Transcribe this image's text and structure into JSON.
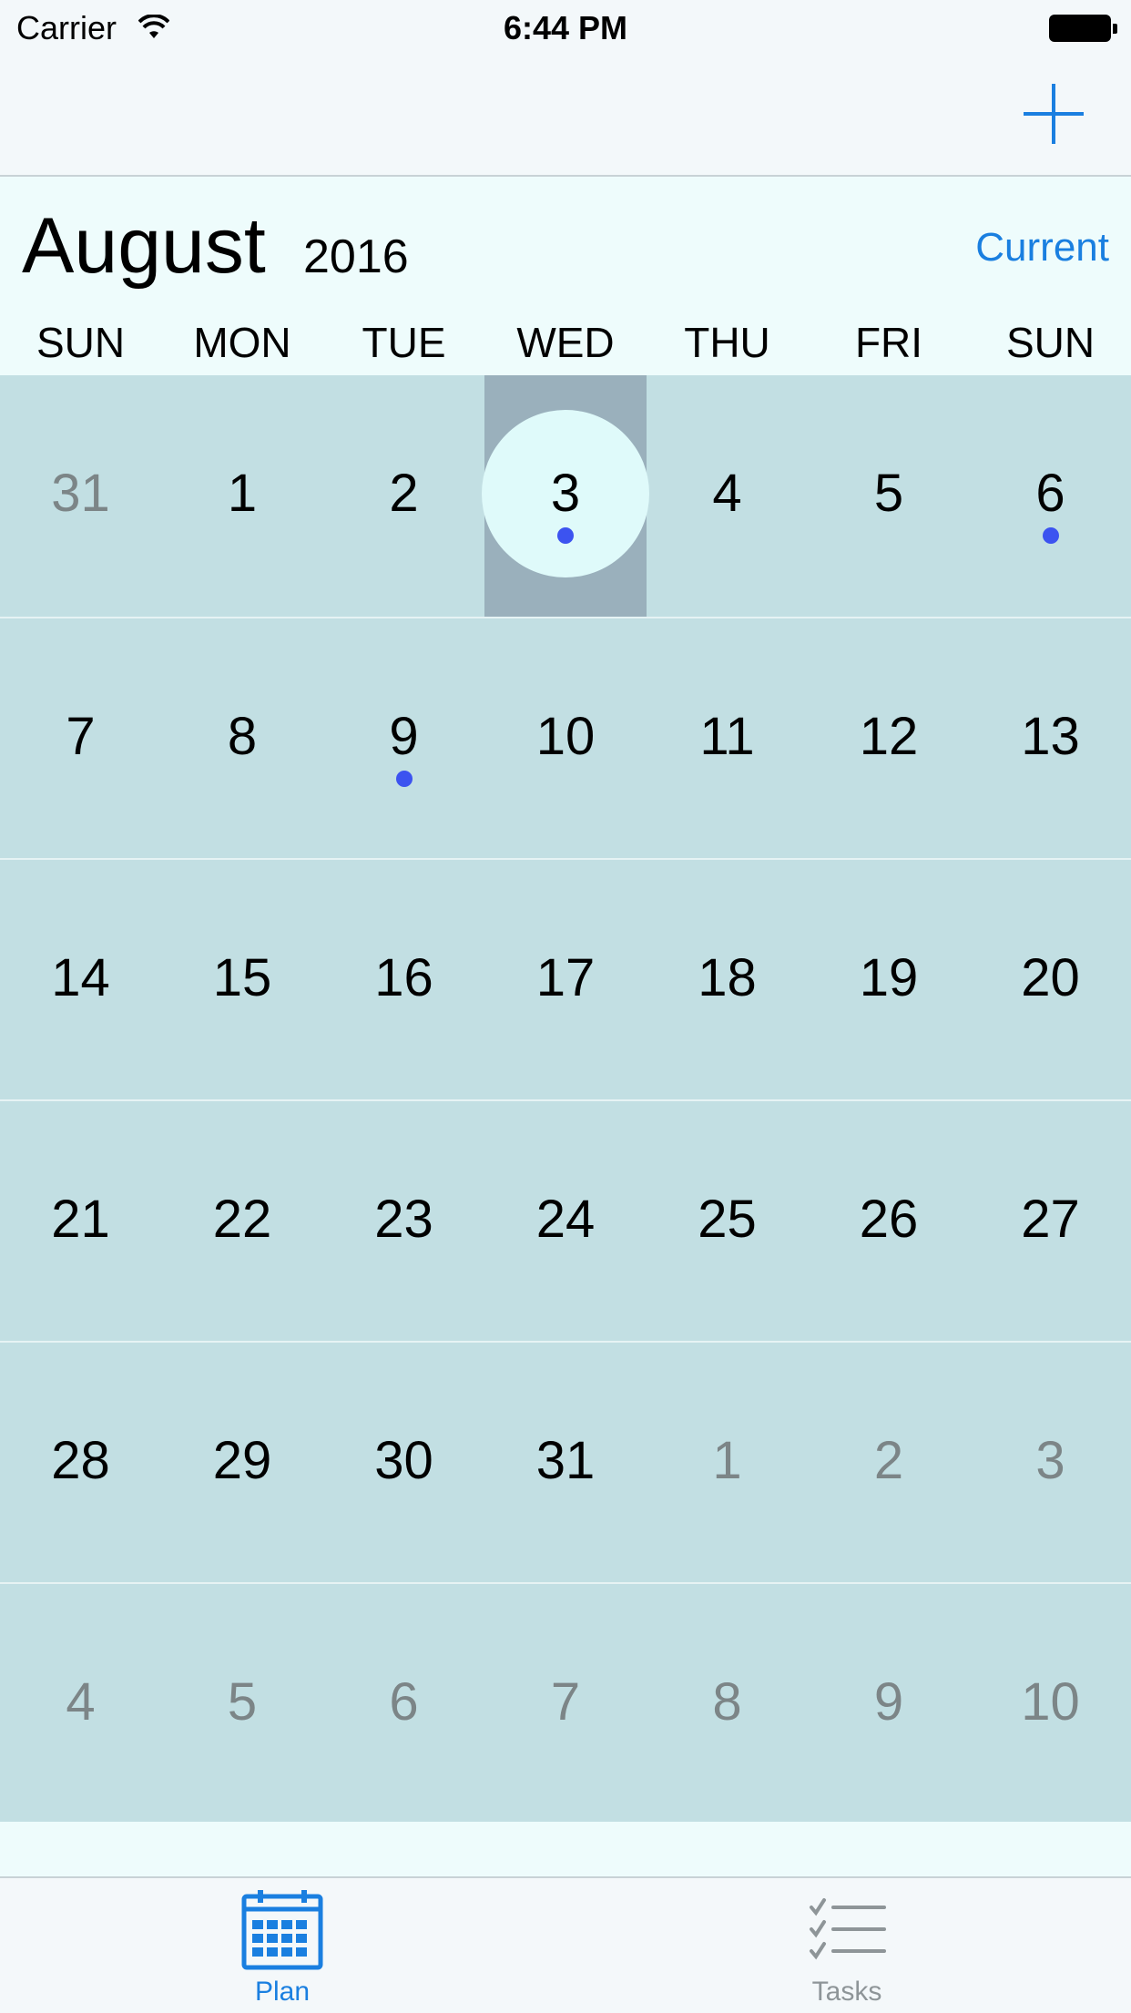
{
  "status_bar": {
    "carrier": "Carrier",
    "time": "6:44 PM"
  },
  "nav": {
    "add_icon": "plus-icon"
  },
  "header": {
    "month": "August",
    "year": "2016",
    "current_label": "Current"
  },
  "weekdays": [
    "SUN",
    "MON",
    "TUE",
    "WED",
    "THU",
    "FRI",
    "SUN"
  ],
  "calendar": {
    "selected": {
      "row": 0,
      "col": 3
    },
    "weeks": [
      [
        {
          "d": "31",
          "muted": true
        },
        {
          "d": "1"
        },
        {
          "d": "2"
        },
        {
          "d": "3",
          "event": true
        },
        {
          "d": "4"
        },
        {
          "d": "5"
        },
        {
          "d": "6",
          "event": true
        }
      ],
      [
        {
          "d": "7"
        },
        {
          "d": "8"
        },
        {
          "d": "9",
          "event": true
        },
        {
          "d": "10"
        },
        {
          "d": "11"
        },
        {
          "d": "12"
        },
        {
          "d": "13"
        }
      ],
      [
        {
          "d": "14"
        },
        {
          "d": "15"
        },
        {
          "d": "16"
        },
        {
          "d": "17"
        },
        {
          "d": "18"
        },
        {
          "d": "19"
        },
        {
          "d": "20"
        }
      ],
      [
        {
          "d": "21"
        },
        {
          "d": "22"
        },
        {
          "d": "23"
        },
        {
          "d": "24"
        },
        {
          "d": "25"
        },
        {
          "d": "26"
        },
        {
          "d": "27"
        }
      ],
      [
        {
          "d": "28"
        },
        {
          "d": "29"
        },
        {
          "d": "30"
        },
        {
          "d": "31"
        },
        {
          "d": "1",
          "muted": true
        },
        {
          "d": "2",
          "muted": true
        },
        {
          "d": "3",
          "muted": true
        }
      ],
      [
        {
          "d": "4",
          "muted": true
        },
        {
          "d": "5",
          "muted": true
        },
        {
          "d": "6",
          "muted": true
        },
        {
          "d": "7",
          "muted": true
        },
        {
          "d": "8",
          "muted": true
        },
        {
          "d": "9",
          "muted": true
        },
        {
          "d": "10",
          "muted": true
        }
      ]
    ]
  },
  "tabs": [
    {
      "label": "Plan",
      "icon": "calendar-icon",
      "active": true
    },
    {
      "label": "Tasks",
      "icon": "checklist-icon",
      "active": false
    }
  ],
  "colors": {
    "accent": "#1a7fe0",
    "event_dot": "#3c53f0",
    "inactive_tab": "#8e9598"
  }
}
